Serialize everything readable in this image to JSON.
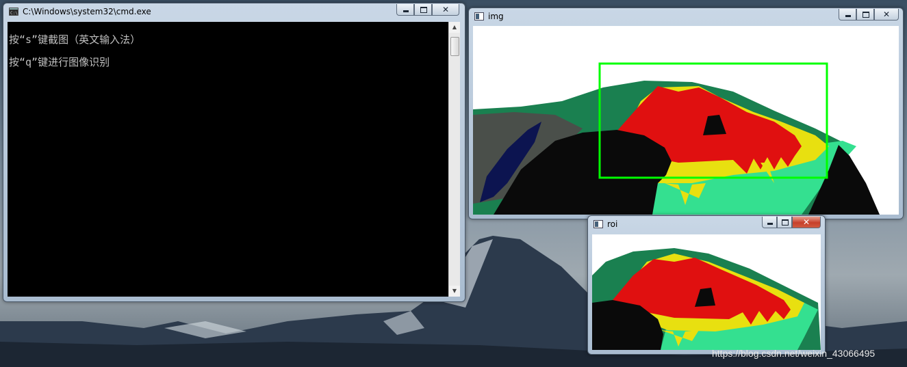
{
  "cmd_window": {
    "title": "C:\\Windows\\system32\\cmd.exe",
    "lines": [
      "按“s”键截图（英文输入法）",
      "按“q”键进行图像识别"
    ]
  },
  "img_window": {
    "title": "img"
  },
  "roi_window": {
    "title": "roi"
  },
  "watermark": "https://blog.csdn.net/weixin_43066495",
  "colors": {
    "red": "#e01010",
    "yellow": "#e8e010",
    "mint": "#34e090",
    "dark_green": "#1a8050",
    "black": "#0a0a0a",
    "navy": "#0c1450",
    "roi_box": "#00ff00"
  },
  "icons": {
    "cmd": "console-icon",
    "img": "image-window-icon",
    "roi": "image-window-icon",
    "minimize": "minimize-icon",
    "maximize": "maximize-icon",
    "close": "close-icon"
  }
}
